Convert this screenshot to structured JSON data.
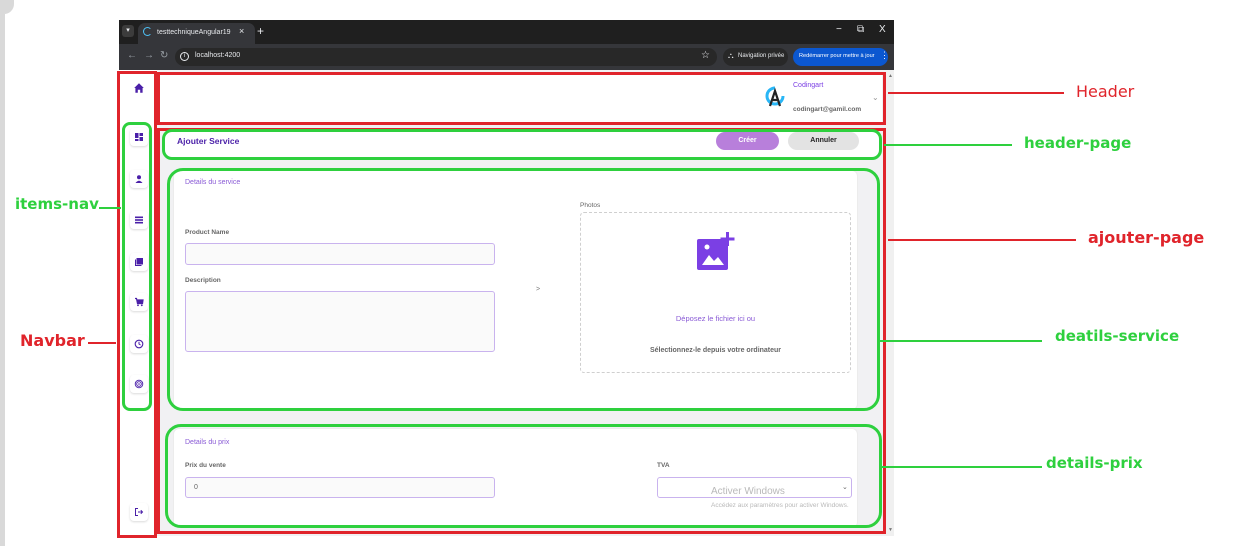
{
  "browser": {
    "tab_title": "testtechniqueAngular19",
    "url": "localhost:4200",
    "incognito_label": "Navigation privée",
    "relaunch_label": "Redémarrer pour mettre à jour",
    "new_tab": "+",
    "close_tab": "×",
    "minimize": "−",
    "restore": "⧉",
    "close": "X"
  },
  "header": {
    "user_name": "Codingart",
    "user_email": "codingart@gamil.com"
  },
  "page_header": {
    "title": "Ajouter Service",
    "create_label": "Créer",
    "cancel_label": "Annuler"
  },
  "service_details": {
    "section_title": "Details du service",
    "product_name_label": "Product Name",
    "product_name_value": "",
    "description_label": "Description",
    "description_value": "",
    "photos_label": "Photos",
    "drop_text": "Déposez le fichier ici ou",
    "select_text": "Sélectionnez-le depuis votre ordinateur",
    "arrow": ">"
  },
  "price_details": {
    "section_title": "Details du prix",
    "price_label": "Prix du vente",
    "price_value": "0",
    "tva_label": "TVA",
    "tva_value": ""
  },
  "watermark": {
    "line1": "Activer Windows",
    "line2": "Accédez aux paramètres pour activer Windows."
  },
  "annotations": {
    "header": "Header",
    "header_page": "header-page",
    "ajouter_page": "ajouter-page",
    "details_service": "deatils-service",
    "details_prix": "details-prix",
    "items_nav": "items-nav",
    "navbar": "Navbar"
  },
  "nav_icons": [
    "home-icon",
    "dashboard-icon",
    "user-icon",
    "list-icon",
    "pdf-icon",
    "cart-icon",
    "clock-icon",
    "fingerprint-icon",
    "logout-icon"
  ],
  "colors": {
    "accent": "#7b3fe4",
    "annotation_red": "#e0242b",
    "annotation_green": "#2ed03e"
  }
}
